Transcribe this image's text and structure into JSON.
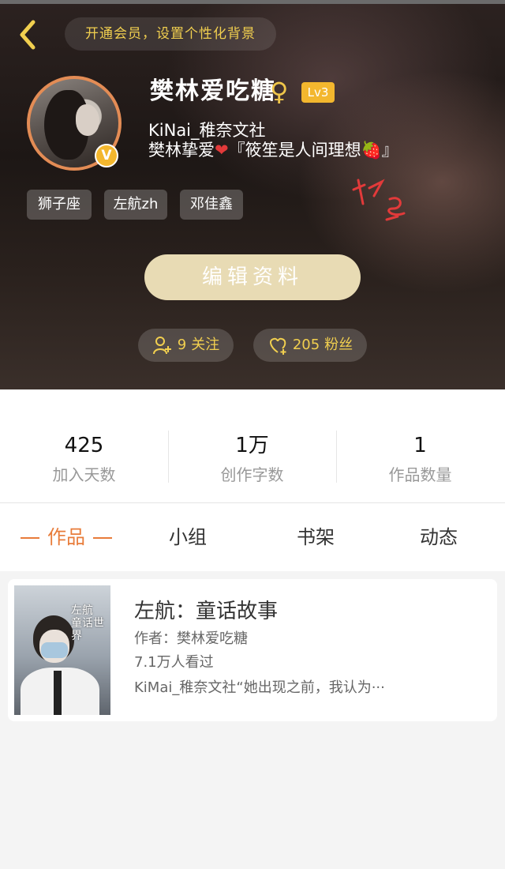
{
  "header": {
    "back_icon": "chevron-left-icon",
    "vip_banner": "开通会员，设置个性化背景"
  },
  "profile": {
    "username": "樊林爱吃糖",
    "gender_symbol": "♀",
    "level": "Lv3",
    "verified_badge": "V",
    "bio_line1": "KiNai_稚奈文社",
    "bio_line2_prefix": "樊林挚爱",
    "bio_heart": "❤",
    "bio_line2_suffix": "『筱笙是人间理想🍓』",
    "tags": [
      "狮子座",
      "左航zh",
      "邓佳鑫"
    ],
    "edit_button": "编辑资料",
    "follow_count": "9",
    "follow_label": "关注",
    "fans_count": "205",
    "fans_label": "粉丝"
  },
  "stats": [
    {
      "value": "425",
      "label": "加入天数"
    },
    {
      "value": "1万",
      "label": "创作字数"
    },
    {
      "value": "1",
      "label": "作品数量"
    }
  ],
  "tabs": [
    "作品",
    "小组",
    "书架",
    "动态"
  ],
  "works": [
    {
      "title": "左航：童话故事",
      "author": "作者：樊林爱吃糖",
      "views": "7.1万人看过",
      "description": "KiMai_稚奈文社“她出现之前，我认为···",
      "cover_text": "左航 童话世界"
    }
  ],
  "colors": {
    "accent_orange": "#e87c3a",
    "gold": "#f1cf4f",
    "edit_button": "#e8dbb4"
  }
}
